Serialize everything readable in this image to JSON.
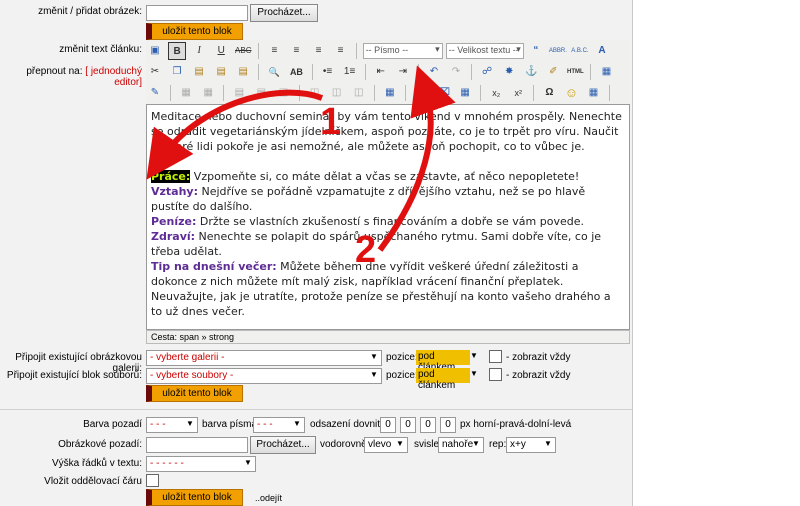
{
  "form": {
    "image_label": "změnit / přidat obrázek:",
    "browse": "Procházet...",
    "save": "uložit tento blok",
    "text_label": "změnit text článku:",
    "toggle_prefix": "přepnout na:",
    "toggle_link": "[ jednoduchý editor]",
    "gallery_label": "Připojit existující obrázkovou galerii:",
    "gallery_value": "- vyberte galerii -",
    "files_label": "Připojit existující blok souborů:",
    "files_value": "- vyberte soubory -",
    "position_label": "pozice:",
    "position_value": "pod článkem",
    "show_always": "- zobrazit vždy",
    "bg_color_label": "Barva pozadí",
    "font_color_label": "barva písma:",
    "dash": "- - -",
    "padding_label": "odsazení dovnitř:",
    "padding_values": [
      "0",
      "0",
      "0",
      "0"
    ],
    "padding_unit": "px horní-pravá-dolní-levá",
    "bg_image_label": "Obrázkové pozadí:",
    "horizontal_label": "vodorovně:",
    "horizontal_value": "vlevo",
    "vertical_label": "svisle:",
    "vertical_value": "nahoře",
    "rep_label": "rep:",
    "rep_value": "x+y",
    "line_height_label": "Výška řádků v textu:",
    "line_height_value": "- - - - - -",
    "divider_label": "Vložit oddělovací čáru",
    "logout": "..odejít"
  },
  "toolbar": {
    "font_family": "-- Písmo --",
    "font_size": "-- Velikost textu --",
    "status": "Cesta: span » strong"
  },
  "editor": {
    "intro": "Meditace nebo duchovní seminář by vám tento víkend v mnohém prospěly. Nenechte se odradit vegetariánským jídelníčkem, aspoň poznáte, co je to trpět pro víru. Naučit některé lidi pokoře je asi nemožné, ale můžete aspoň pochopit, co to vůbec je.",
    "items": [
      {
        "head": "Práce:",
        "text": " Vzpomeňte si, co máte dělat a včas se zastavte, ať něco nepopletete!"
      },
      {
        "head": "Vztahy:",
        "text": " Nejdříve se pořádně vzpamatujte z dřívějšího vztahu, než se po hlavě pustíte do dalšího."
      },
      {
        "head": "Peníze:",
        "text": " Držte se vlastních zkušeností s financováním a dobře se vám povede."
      },
      {
        "head": "Zdraví:",
        "text": " Nenechte se polapit do spárů uspěchaného rytmu. Sami dobře víte, co je třeba udělat."
      },
      {
        "head": "Tip na dnešní večer:",
        "text": " Můžete během dne vyřídit veškeré úřední záležitosti a dokonce z nich můžete mít malý zisk, například vrácení finanční přeplatek. Neuvažujte, jak je utratíte, protože peníze se přestěhují na konto vašeho drahého a to už dnes večer."
      }
    ]
  },
  "annotations": {
    "arrow1": "1",
    "arrow2": "2",
    "color": "#e11010"
  }
}
